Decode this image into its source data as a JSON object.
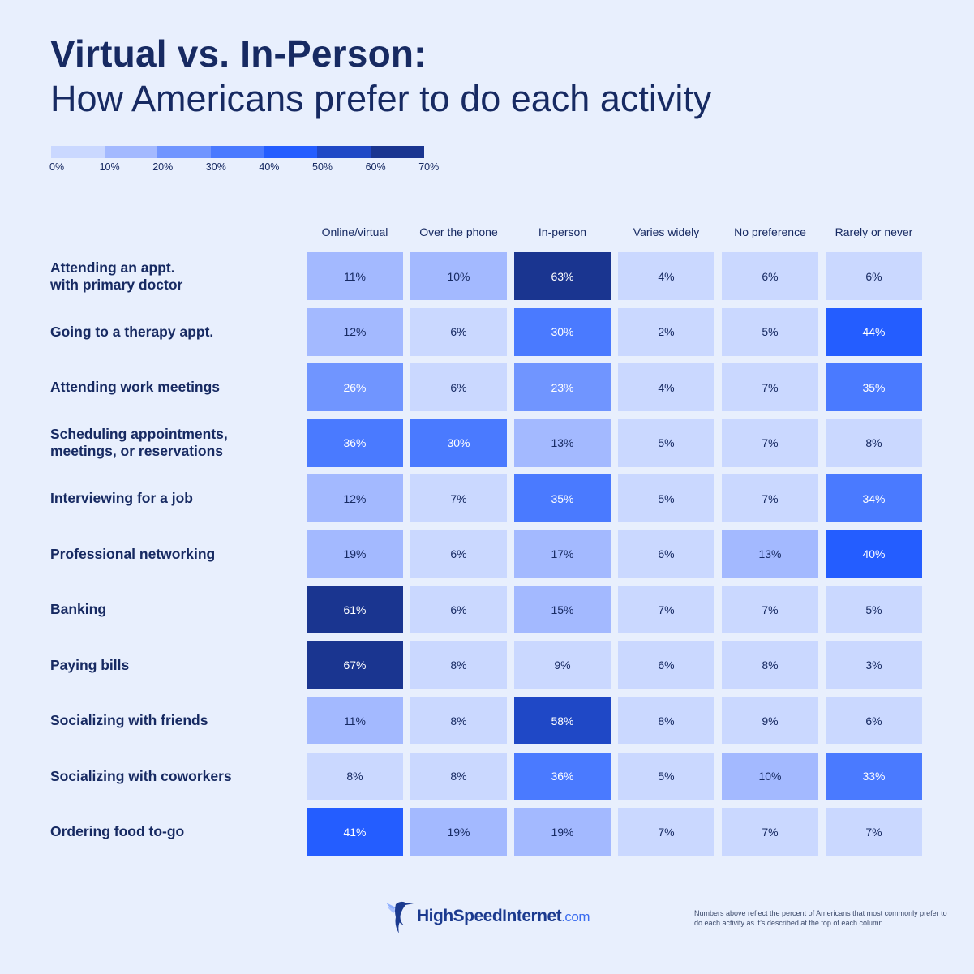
{
  "header": {
    "title": "Virtual vs. In-Person:",
    "subtitle": "How Americans prefer to do each activity"
  },
  "legend": {
    "ticks": [
      "0%",
      "10%",
      "20%",
      "30%",
      "40%",
      "50%",
      "60%",
      "70%"
    ],
    "colors": [
      "#cad8ff",
      "#a3b9ff",
      "#7095ff",
      "#4a7aff",
      "#245dff",
      "#1f48c6",
      "#1a3590"
    ]
  },
  "chart_data": {
    "type": "heatmap",
    "title": "Virtual vs. In-Person: How Americans prefer to do each activity",
    "columns": [
      "Online/virtual",
      "Over the phone",
      "In-person",
      "Varies widely",
      "No preference",
      "Rarely or never"
    ],
    "rows": [
      "Attending an appt.\nwith primary doctor",
      "Going to a therapy appt.",
      "Attending work meetings",
      "Scheduling appointments,\nmeetings, or reservations",
      "Interviewing for a job",
      "Professional networking",
      "Banking",
      "Paying bills",
      "Socializing with friends",
      "Socializing with coworkers",
      "Ordering food to-go"
    ],
    "values": [
      [
        11,
        10,
        63,
        4,
        6,
        6
      ],
      [
        12,
        6,
        30,
        2,
        5,
        44
      ],
      [
        26,
        6,
        23,
        4,
        7,
        35
      ],
      [
        36,
        30,
        13,
        5,
        7,
        8
      ],
      [
        12,
        7,
        35,
        5,
        7,
        34
      ],
      [
        19,
        6,
        17,
        6,
        13,
        40
      ],
      [
        61,
        6,
        15,
        7,
        7,
        5
      ],
      [
        67,
        8,
        9,
        6,
        8,
        3
      ],
      [
        11,
        8,
        58,
        8,
        9,
        6
      ],
      [
        8,
        8,
        36,
        5,
        10,
        33
      ],
      [
        41,
        19,
        19,
        7,
        7,
        7
      ]
    ],
    "unit": "%",
    "color_scale": {
      "min": 0,
      "max": 70,
      "step": 10
    }
  },
  "footer": {
    "logo_main": "HighSpeedInternet",
    "logo_suffix": ".com",
    "note": "Numbers above reflect the percent of Americans that most commonly prefer to do each activity as it’s described at the top of each column."
  }
}
